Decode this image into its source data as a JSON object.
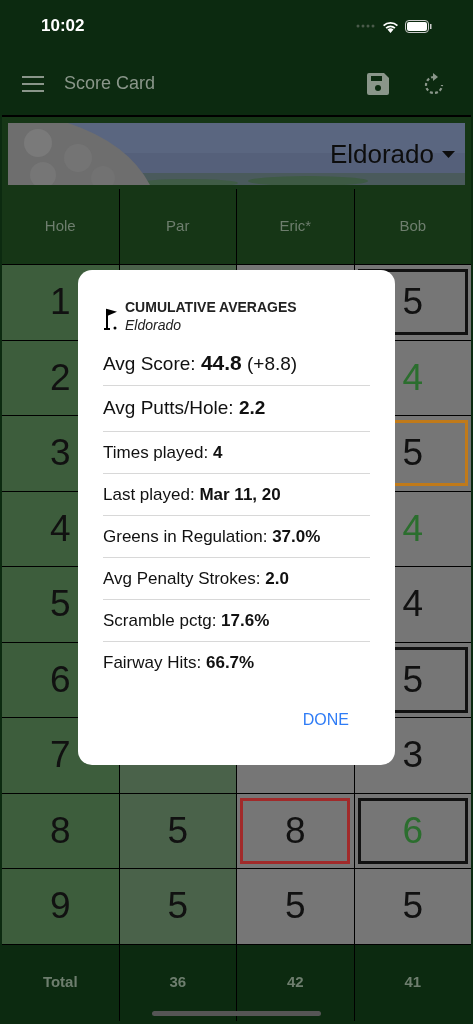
{
  "status_bar": {
    "time": "10:02"
  },
  "toolbar": {
    "title": "Score Card"
  },
  "course": {
    "name": "Eldorado"
  },
  "columns": [
    "Hole",
    "Par",
    "Eric*",
    "Bob"
  ],
  "rows": [
    {
      "hole": "1",
      "bob": {
        "value": "5",
        "boxed": true,
        "color": "#111111",
        "under_par": false
      }
    },
    {
      "hole": "2",
      "bob": {
        "value": "4",
        "boxed": false,
        "under_par": true
      }
    },
    {
      "hole": "3",
      "bob": {
        "value": "5",
        "boxed": true,
        "color": "#c07a1a",
        "under_par": false
      }
    },
    {
      "hole": "4",
      "bob": {
        "value": "4",
        "boxed": false,
        "under_par": true
      }
    },
    {
      "hole": "5",
      "bob": {
        "value": "4",
        "boxed": false,
        "under_par": false
      }
    },
    {
      "hole": "6",
      "bob": {
        "value": "5",
        "boxed": true,
        "color": "#111111",
        "under_par": false
      }
    },
    {
      "hole": "7",
      "bob": {
        "value": "3",
        "boxed": false,
        "under_par": false
      }
    },
    {
      "hole": "8",
      "par": "5",
      "eric": {
        "value": "8",
        "boxed": true,
        "color": "#a12a2a",
        "under_par": false
      },
      "bob": {
        "value": "6",
        "boxed": true,
        "color": "#111111",
        "under_par": true
      }
    },
    {
      "hole": "9",
      "par": "5",
      "eric": {
        "value": "5",
        "boxed": false,
        "under_par": false
      },
      "bob": {
        "value": "5",
        "boxed": false,
        "under_par": false
      }
    }
  ],
  "totals": [
    "Total",
    "36",
    "42",
    "41"
  ],
  "dialog": {
    "title": "CUMULATIVE AVERAGES",
    "subtitle": "Eldorado",
    "stats": [
      {
        "kind": "large",
        "label": "Avg Score:",
        "value": "44.8",
        "suffix": "(+8.8)"
      },
      {
        "kind": "large",
        "label": "Avg Putts/Hole:",
        "value": "2.2"
      },
      {
        "kind": "normal",
        "label": "Times played:",
        "value": "4"
      },
      {
        "kind": "normal",
        "label": "Last played:",
        "value": "Mar 11, 20"
      },
      {
        "kind": "normal",
        "label": "Greens in Regulation:",
        "value": "37.0%"
      },
      {
        "kind": "normal",
        "label": "Avg Penalty Strokes:",
        "value": "2.0"
      },
      {
        "kind": "normal",
        "label": "Scramble pctg:",
        "value": "17.6%"
      },
      {
        "kind": "normal",
        "label": "Fairway Hits:",
        "value": "66.7%"
      }
    ],
    "button": "DONE"
  }
}
